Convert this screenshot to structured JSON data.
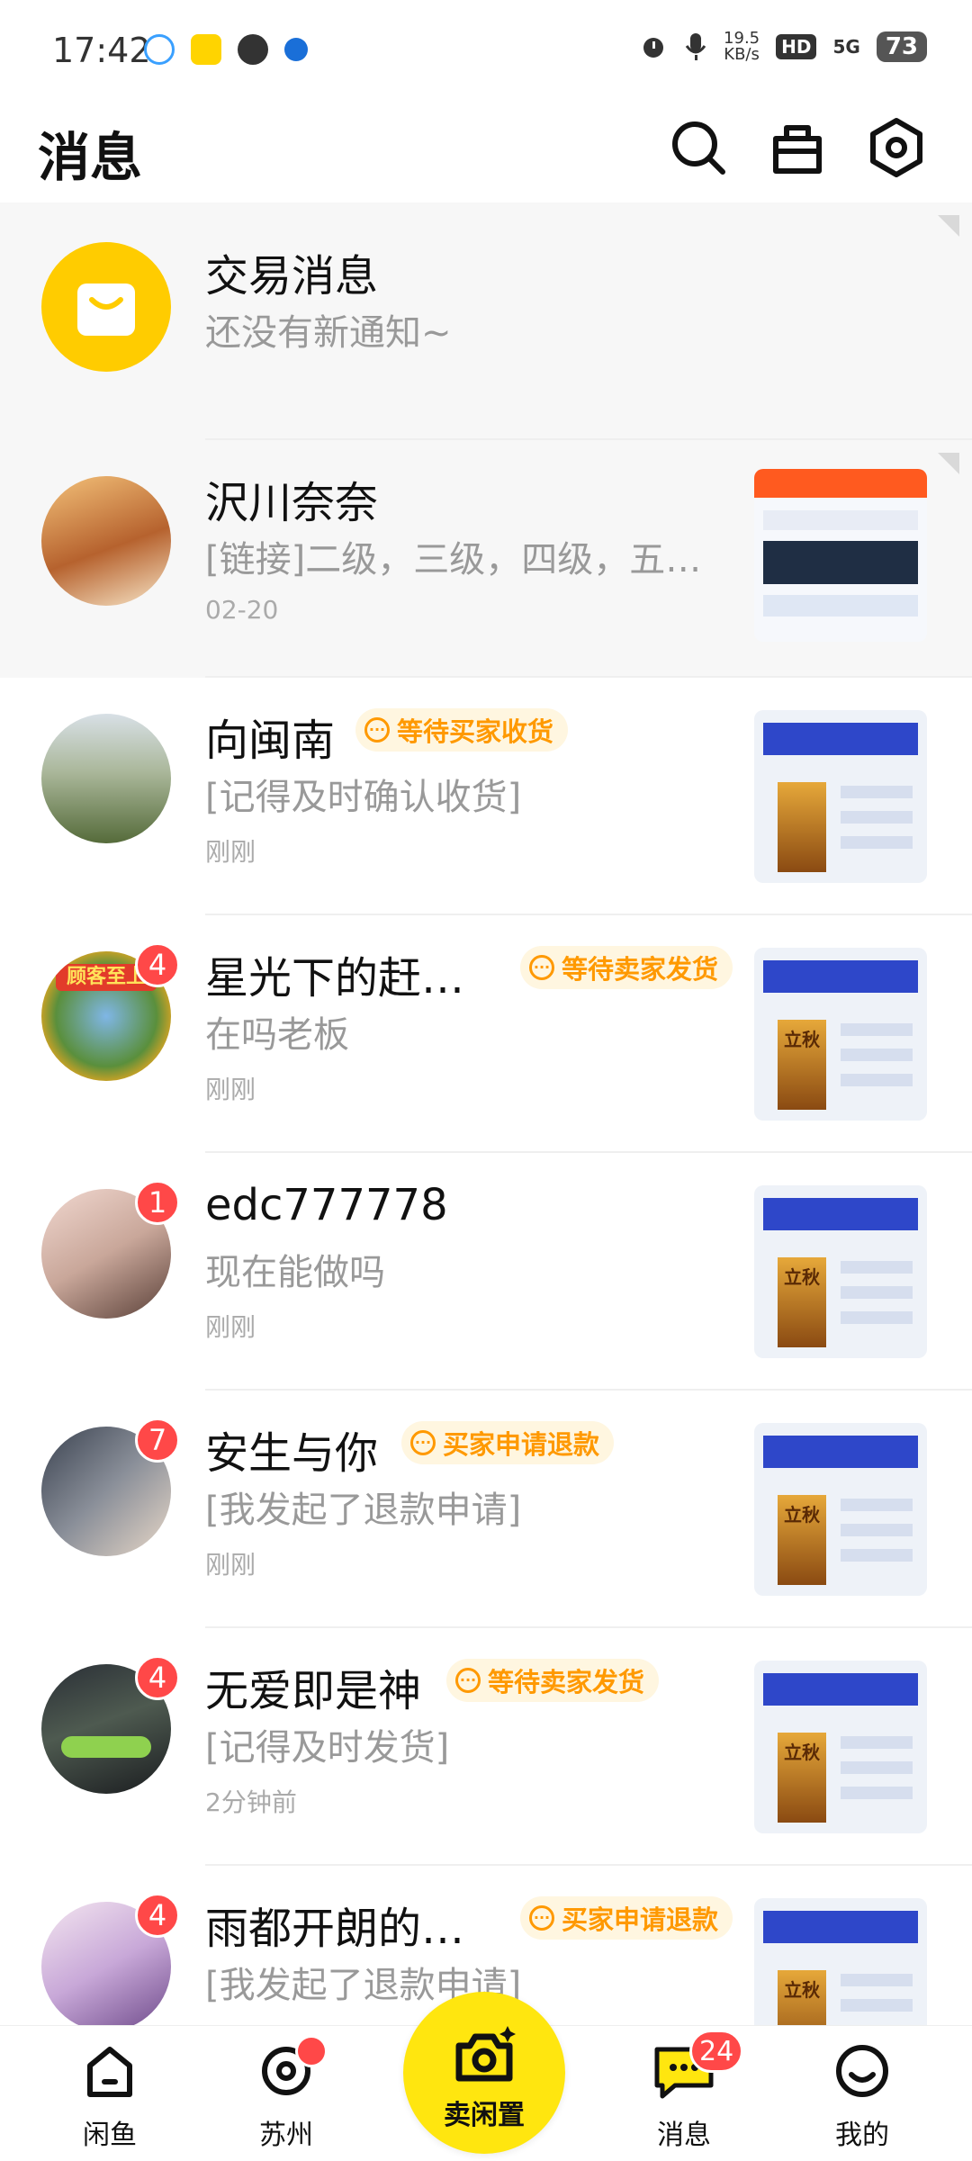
{
  "status_bar": {
    "time": "17:42",
    "net_speed_value": "19.5",
    "net_speed_unit": "KB/s",
    "hd": "HD",
    "network": "5G",
    "battery": "73"
  },
  "header": {
    "title": "消息",
    "icons": [
      "search-icon",
      "store-icon",
      "settings-icon"
    ]
  },
  "messages": [
    {
      "name": "交易消息",
      "preview": "还没有新通知~",
      "time": "",
      "tag": "",
      "badge": "",
      "icon": "shopping-bag-icon",
      "pinned": true
    },
    {
      "name": "沢川奈奈",
      "preview": "[链接]二级，三级，四级，五…",
      "time": "02-20",
      "tag": "",
      "badge": "",
      "pinned": true
    },
    {
      "name": "向闽南",
      "preview": "[记得及时确认收货]",
      "time": "刚刚",
      "tag": "等待买家收货",
      "badge": ""
    },
    {
      "name": "星光下的赶…",
      "preview": "在吗老板",
      "time": "刚刚",
      "tag": "等待卖家发货",
      "badge": "4",
      "avatar_text": "顾客至上"
    },
    {
      "name": "edc777778",
      "preview": "现在能做吗",
      "time": "刚刚",
      "tag": "",
      "badge": "1"
    },
    {
      "name": "安生与你",
      "preview": "[我发起了退款申请]",
      "time": "刚刚",
      "tag": "买家申请退款",
      "badge": "7"
    },
    {
      "name": "无爱即是神",
      "preview": "[记得及时发货]",
      "time": "2分钟前",
      "tag": "等待卖家发货",
      "badge": "4"
    },
    {
      "name": "雨都开朗的…",
      "preview": "[我发起了退款申请]",
      "time": "",
      "tag": "买家申请退款",
      "badge": "4"
    }
  ],
  "thumb_text": {
    "big_char": "立秋"
  },
  "bottom_nav": {
    "items": [
      {
        "label": "闲鱼",
        "icon": "home-icon"
      },
      {
        "label": "苏州",
        "icon": "location-icon"
      },
      {
        "label": "卖闲置",
        "icon": "camera-sparkle-icon"
      },
      {
        "label": "消息",
        "icon": "chat-bubble-icon",
        "badge": "24"
      },
      {
        "label": "我的",
        "icon": "smile-icon"
      }
    ]
  },
  "colors": {
    "brand_yellow": "#ffe60f",
    "badge_red": "#ff4848",
    "tag_orange": "#ff9900",
    "tag_bg": "#fff6e0"
  }
}
